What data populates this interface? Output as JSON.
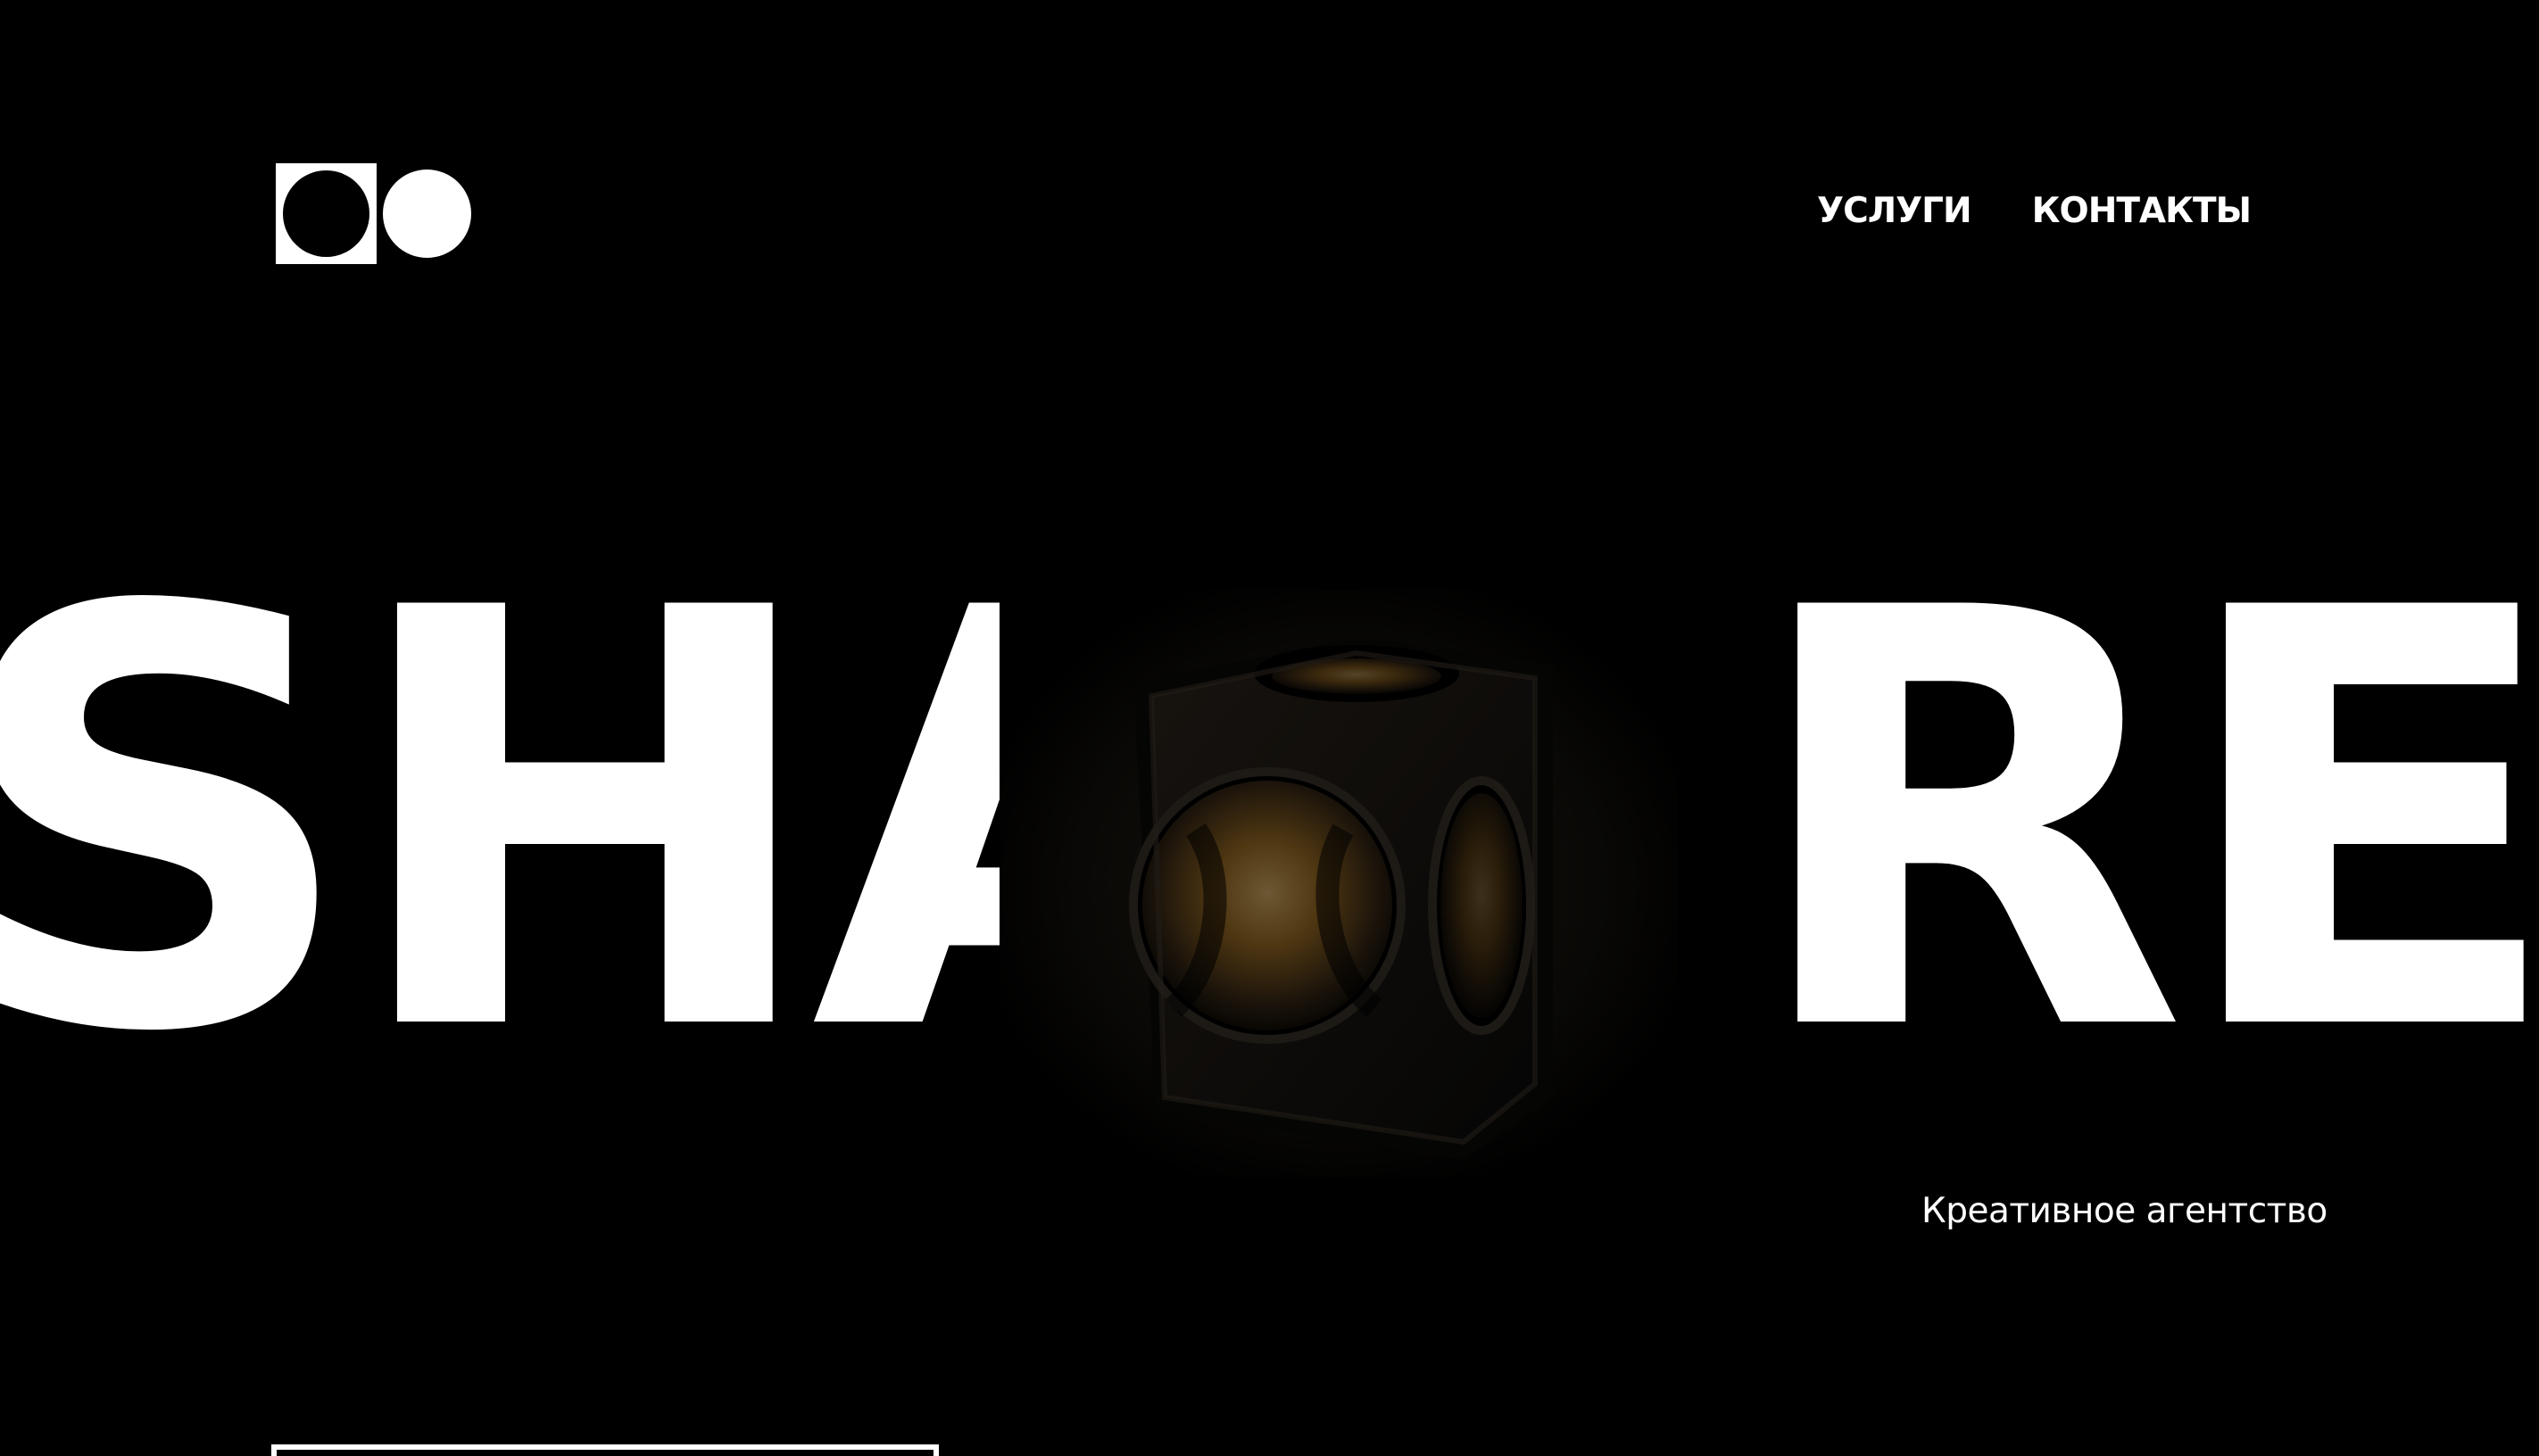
{
  "logo": {
    "name": "logo"
  },
  "nav": {
    "items": [
      {
        "label": "УСЛУГИ"
      },
      {
        "label": "КОНТАКТЫ"
      }
    ]
  },
  "hero": {
    "left_text": "SHA",
    "right_text": "RE",
    "visual_icon": "cube-icon"
  },
  "tagline": "Креативное агентство",
  "colors": {
    "background": "#000000",
    "text": "#ffffff",
    "accent": "#b07a28"
  }
}
